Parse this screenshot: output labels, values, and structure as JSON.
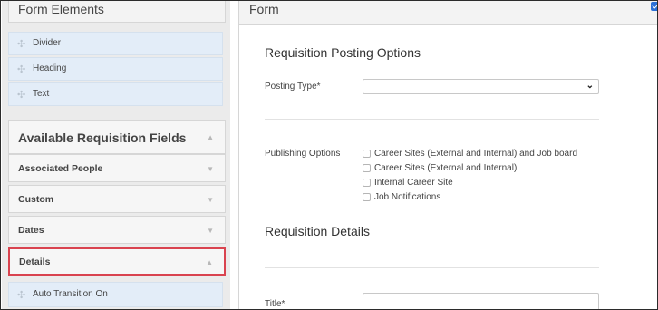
{
  "left_panel": {
    "form_elements_title": "Form Elements",
    "elements": [
      {
        "label": "Divider"
      },
      {
        "label": "Heading"
      },
      {
        "label": "Text"
      }
    ],
    "available_fields_title": "Available Requisition Fields",
    "sections": [
      {
        "label": "Associated People",
        "state": "collapsed"
      },
      {
        "label": "Custom",
        "state": "collapsed"
      },
      {
        "label": "Dates",
        "state": "collapsed"
      },
      {
        "label": "Details",
        "state": "expanded",
        "highlighted": true
      }
    ],
    "details_fields": [
      {
        "label": "Auto Transition On"
      }
    ],
    "icons": {
      "grip": "drag-handle-icon",
      "collapsed": "chevron-down-icon",
      "expanded": "chevron-up-icon"
    }
  },
  "form": {
    "title": "Form",
    "posting_options": {
      "heading": "Requisition Posting Options",
      "posting_type_label": "Posting Type*",
      "posting_type_value": "",
      "publishing_label": "Publishing Options",
      "publishing_options": [
        {
          "label": "Career Sites (External and Internal) and Job board",
          "checked": false
        },
        {
          "label": "Career Sites (External and Internal)",
          "checked": false
        },
        {
          "label": "Internal Career Site",
          "checked": false
        },
        {
          "label": "Job Notifications",
          "checked": false
        }
      ]
    },
    "details": {
      "heading": "Requisition Details",
      "title_label": "Title*",
      "title_value": ""
    }
  },
  "colors": {
    "highlight_border": "#d9434f",
    "drag_item_bg": "#e3edf8",
    "checkbox_accent": "#2b6fd6"
  }
}
